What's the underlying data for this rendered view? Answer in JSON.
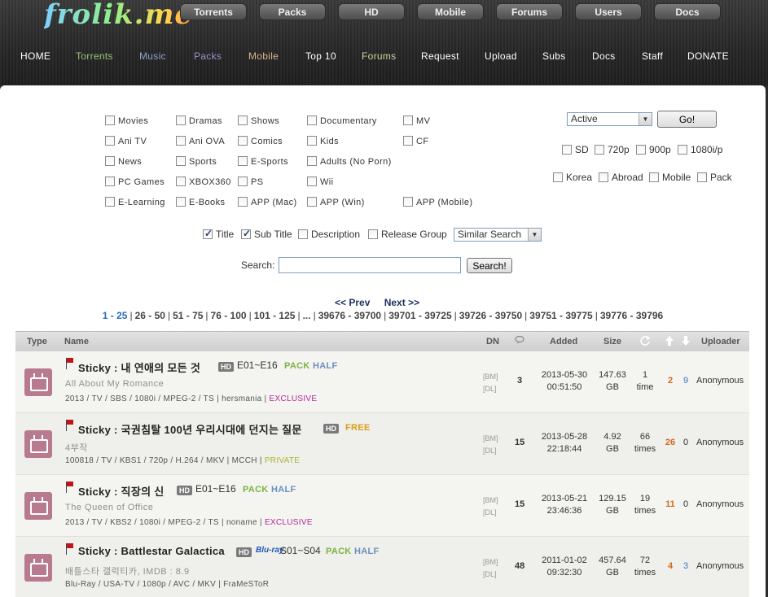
{
  "site": {
    "logo_text": "frolik.me"
  },
  "top_buttons": [
    "Torrents",
    "Packs",
    "HD",
    "Mobile",
    "Forums",
    "Users",
    "Docs"
  ],
  "main_nav": [
    {
      "label": "HOME",
      "color": "#ffffff"
    },
    {
      "label": "Torrents",
      "color": "#9bc27a"
    },
    {
      "label": "Music",
      "color": "#8fa3c8"
    },
    {
      "label": "Packs",
      "color": "#9a8fc8"
    },
    {
      "label": "Mobile",
      "color": "#d7b98a"
    },
    {
      "label": "Top 10",
      "color": "#ffffff"
    },
    {
      "label": "Forums",
      "color": "#c8d89a"
    },
    {
      "label": "Request",
      "color": "#ffffff"
    },
    {
      "label": "Upload",
      "color": "#ffffff"
    },
    {
      "label": "Subs",
      "color": "#ffffff"
    },
    {
      "label": "Docs",
      "color": "#ffffff"
    },
    {
      "label": "Staff",
      "color": "#ffffff"
    },
    {
      "label": "DONATE",
      "color": "#ffffff"
    }
  ],
  "categories": [
    {
      "label": "Movies",
      "checked": false
    },
    {
      "label": "Dramas",
      "checked": false
    },
    {
      "label": "Shows",
      "checked": false
    },
    {
      "label": "Documentary",
      "checked": false
    },
    {
      "label": "MV",
      "checked": false
    },
    {
      "label": "Ani TV",
      "checked": false
    },
    {
      "label": "Ani OVA",
      "checked": false
    },
    {
      "label": "Comics",
      "checked": false
    },
    {
      "label": "Kids",
      "checked": false
    },
    {
      "label": "CF",
      "checked": false
    },
    {
      "label": "News",
      "checked": false
    },
    {
      "label": "Sports",
      "checked": false
    },
    {
      "label": "E-Sports",
      "checked": false
    },
    {
      "label": "Adults (No Porn)",
      "checked": false
    },
    {
      "label": "PC Games",
      "checked": false
    },
    {
      "label": "XBOX360",
      "checked": false
    },
    {
      "label": "PS",
      "checked": false
    },
    {
      "label": "Wii",
      "checked": false
    },
    {
      "label": "E-Learning",
      "checked": false
    },
    {
      "label": "E-Books",
      "checked": false
    },
    {
      "label": "APP (Mac)",
      "checked": false
    },
    {
      "label": "APP (Win)",
      "checked": false
    },
    {
      "label": "APP (Mobile)",
      "checked": false
    }
  ],
  "status_select": {
    "value": "Active",
    "button": "Go!"
  },
  "quality_filters": [
    {
      "label": "SD",
      "checked": false
    },
    {
      "label": "720p",
      "checked": false
    },
    {
      "label": "900p",
      "checked": false
    },
    {
      "label": "1080i/p",
      "checked": false
    }
  ],
  "region_filters": [
    {
      "label": "Korea",
      "checked": false
    },
    {
      "label": "Abroad",
      "checked": false
    },
    {
      "label": "Mobile",
      "checked": false
    },
    {
      "label": "Pack",
      "checked": false
    }
  ],
  "search_fields": [
    {
      "label": "Title",
      "checked": true
    },
    {
      "label": "Sub Title",
      "checked": true
    },
    {
      "label": "Description",
      "checked": false
    },
    {
      "label": "Release Group",
      "checked": false
    }
  ],
  "search_mode": "Similar Search",
  "search": {
    "label": "Search:",
    "value": "",
    "button": "Search!"
  },
  "pager": {
    "prev": "<< Prev",
    "next": "Next >>",
    "pages": [
      "1 - 25",
      "26 - 50",
      "51 - 75",
      "76 - 100",
      "101 - 125",
      "...",
      "39676 - 39700",
      "39701 - 39725",
      "39726 - 39750",
      "39751 - 39775",
      "39776 - 39796"
    ]
  },
  "table": {
    "headers": {
      "type": "Type",
      "name": "Name",
      "dn": "DN",
      "added": "Added",
      "size": "Size",
      "uploader": "Uploader"
    },
    "rows": [
      {
        "title": "Sticky : 내 연애의 모든 것",
        "badge": "HD",
        "bluray": "",
        "episodes": "E01~E16",
        "tags": [
          {
            "text": "PACK",
            "color": "#7cb342"
          },
          {
            "text": "HALF",
            "color": "#6c8fc0"
          }
        ],
        "subtitle": "All About My Romance",
        "meta": "2013 / TV / SBS / 1080i / MPEG-2 / TS | hersmania | ",
        "meta_tag": "EXCLUSIVE",
        "meta_tag_class": "excl",
        "dn1": "[BM]",
        "dn2": "[DL]",
        "comments": "3",
        "date": "2013-05-30",
        "time": "00:51:50",
        "size_num": "147.63",
        "size_unit": "GB",
        "snatched": "1",
        "snatched_unit": "time",
        "seeders": "2",
        "leechers": "9",
        "leech_color": "#3a7ac8",
        "uploader": "Anonymous"
      },
      {
        "title": "Sticky : 국권침탈 100년 우리시대에 던지는 질문",
        "badge": "HD",
        "bluray": "",
        "episodes": "",
        "tags": [
          {
            "text": "FREE",
            "color": "#d4a017"
          }
        ],
        "subtitle": "4부작",
        "meta": "100818 / TV / KBS1 / 720p / H.264 / MKV | MCCH | ",
        "meta_tag": "PRIVATE",
        "meta_tag_class": "priv",
        "dn1": "[BM]",
        "dn2": "[DL]",
        "comments": "15",
        "date": "2013-05-28",
        "time": "22:18:44",
        "size_num": "4.92",
        "size_unit": "GB",
        "snatched": "66",
        "snatched_unit": "times",
        "seeders": "26",
        "leechers": "0",
        "leech_color": "#333333",
        "uploader": "Anonymous"
      },
      {
        "title": "Sticky : 직장의 신",
        "badge": "HD",
        "bluray": "",
        "episodes": "E01~E16",
        "tags": [
          {
            "text": "PACK",
            "color": "#7cb342"
          },
          {
            "text": "HALF",
            "color": "#6c8fc0"
          }
        ],
        "subtitle": "The Queen of Office",
        "meta": "2013 / TV / KBS2 / 1080i / MPEG-2 / TS | noname | ",
        "meta_tag": "EXCLUSIVE",
        "meta_tag_class": "excl",
        "dn1": "[BM]",
        "dn2": "[DL]",
        "comments": "15",
        "date": "2013-05-21",
        "time": "23:46:36",
        "size_num": "129.15",
        "size_unit": "GB",
        "snatched": "19",
        "snatched_unit": "times",
        "seeders": "11",
        "leechers": "0",
        "leech_color": "#333333",
        "uploader": "Anonymous"
      },
      {
        "title": "Sticky : Battlestar Galactica",
        "badge": "HD",
        "bluray": "Blu-ray",
        "episodes": "S01~S04",
        "tags": [
          {
            "text": "PACK",
            "color": "#7cb342"
          },
          {
            "text": "HALF",
            "color": "#6c8fc0"
          }
        ],
        "subtitle": "배틀스타 갤럭티카, IMDB : 8.9",
        "meta": "Blu-Ray / USA-TV / 1080p / AVC / MKV | FraMeSToR",
        "meta_tag": "",
        "meta_tag_class": "",
        "dn1": "[BM]",
        "dn2": "[DL]",
        "comments": "48",
        "date": "2011-01-02",
        "time": "09:32:30",
        "size_num": "457.64",
        "size_unit": "GB",
        "snatched": "72",
        "snatched_unit": "times",
        "seeders": "4",
        "leechers": "3",
        "leech_color": "#3a7ac8",
        "uploader": "Anonymous"
      }
    ]
  }
}
